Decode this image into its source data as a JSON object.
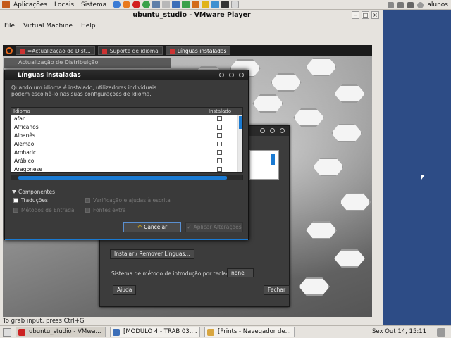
{
  "host_panel": {
    "menus": [
      "Aplicações",
      "Locais",
      "Sistema"
    ],
    "user": "alunos"
  },
  "vmware": {
    "title": "ubuntu_studio - VMware Player",
    "menu": [
      "File",
      "Virtual Machine",
      "Help"
    ],
    "status": "To grab input, press Ctrl+G"
  },
  "guest": {
    "tabs": [
      {
        "label": "=Actualização de Dist..."
      },
      {
        "label": "Suporte de idioma"
      },
      {
        "label": "Línguas instaladas"
      }
    ],
    "bg_window_title": "Actualização de Distribuição",
    "support_dialog": {
      "install_button": "Instalar / Remover Línguas...",
      "input_method_label": "Sistema de método de introdução por teclado:",
      "input_method_value": "none",
      "help_button": "Ajuda",
      "close_button": "Fechar"
    },
    "languages_dialog": {
      "title": "Línguas instaladas",
      "description": "Quando um idioma é instalado, utilizadores individuais podem escolhê-lo nas suas configurações de Idioma.",
      "columns": {
        "language": "Idioma",
        "installed": "Instalado"
      },
      "rows": [
        {
          "name": "afar",
          "installed": false
        },
        {
          "name": "Africanos",
          "installed": false
        },
        {
          "name": "Albanês",
          "installed": false
        },
        {
          "name": "Alemão",
          "installed": false
        },
        {
          "name": "Amharic",
          "installed": false
        },
        {
          "name": "Arábico",
          "installed": false
        },
        {
          "name": "Aragonese",
          "installed": false
        }
      ],
      "components_label": "Componentes:",
      "components": {
        "translations": "Traduções",
        "input_methods": "Métodos de Entrada",
        "writing_aids": "Verificação e ajudas à escrita",
        "extra_fonts": "Fontes extra"
      },
      "cancel_button": "Cancelar",
      "apply_button": "Aplicar Alterações"
    }
  },
  "taskbar": {
    "items": [
      {
        "label": "ubuntu_studio - VMwa..."
      },
      {
        "label": "[MODULO 4 - TRAB 03...."
      },
      {
        "label": "[Prints - Navegador de..."
      }
    ],
    "clock": "Sex Out 14, 15:11"
  },
  "colors": {
    "accent": "#1a7ad2",
    "desktop": "#2e4a80"
  }
}
